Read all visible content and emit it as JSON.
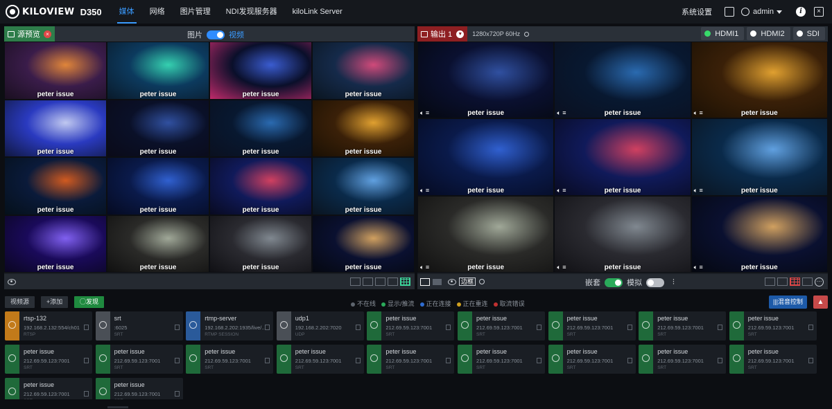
{
  "brand": {
    "logo": "KILOVIEW",
    "model": "D350"
  },
  "nav": [
    "媒体",
    "网络",
    "图片管理",
    "NDI发现服务器",
    "kiloLink Server"
  ],
  "topright": {
    "settings": "系统设置",
    "user": "admin"
  },
  "preview": {
    "tag": "源预览",
    "toggle_left": "图片",
    "toggle_right": "视频",
    "cells": [
      {
        "caption": "peter issue",
        "colors": [
          "#3a1c4a",
          "#e0853a",
          "#1a0f20"
        ]
      },
      {
        "caption": "peter issue",
        "colors": [
          "#0c3a5e",
          "#35d0b0",
          "#0a1a2a"
        ]
      },
      {
        "caption": "peter issue",
        "colors": [
          "#0a0f2a",
          "#3a5cd0",
          "#c02a6a"
        ]
      },
      {
        "caption": "peter issue",
        "colors": [
          "#152a4a",
          "#d04a7a",
          "#0a1520"
        ]
      },
      {
        "caption": "peter issue",
        "colors": [
          "#2a3ac0",
          "#c0c8f0",
          "#101840"
        ]
      },
      {
        "caption": "peter issue",
        "colors": [
          "#0a1028",
          "#3050a0",
          "#0a0a18"
        ]
      },
      {
        "caption": "peter issue",
        "colors": [
          "#081830",
          "#2a6ab0",
          "#0a1020"
        ]
      },
      {
        "caption": "peter issue",
        "colors": [
          "#3a2008",
          "#e0a030",
          "#1a1004"
        ]
      },
      {
        "caption": "peter issue",
        "colors": [
          "#0a1a3a",
          "#d05a20",
          "#05101a"
        ]
      },
      {
        "caption": "peter issue",
        "colors": [
          "#0a1a4a",
          "#3060d0",
          "#050a20"
        ]
      },
      {
        "caption": "peter issue",
        "colors": [
          "#101a5a",
          "#d04060",
          "#080a20"
        ]
      },
      {
        "caption": "peter issue",
        "colors": [
          "#0a2a4a",
          "#60a0e0",
          "#0a1420"
        ]
      },
      {
        "caption": "peter issue",
        "colors": [
          "#1a0a5a",
          "#8060f0",
          "#0a0620"
        ]
      },
      {
        "caption": "peter issue",
        "colors": [
          "#2a2a28",
          "#a0a898",
          "#101010"
        ]
      },
      {
        "caption": "peter issue",
        "colors": [
          "#2a2a30",
          "#808890",
          "#101014"
        ]
      },
      {
        "caption": "peter issue",
        "colors": [
          "#0a1030",
          "#d0a060",
          "#050810"
        ]
      }
    ]
  },
  "output": {
    "tag": "输出 1",
    "resolution": "1280x720P 60Hz",
    "ports": [
      {
        "label": "HDMI1",
        "active": true
      },
      {
        "label": "HDMI2",
        "active": false
      },
      {
        "label": "SDI",
        "active": false
      }
    ],
    "border_label": "边框",
    "ctrl_left": "嵌套",
    "ctrl_right": "模拟",
    "cells": [
      {
        "caption": "peter issue",
        "colors": [
          "#0a1030",
          "#3050a0",
          "#05080f"
        ]
      },
      {
        "caption": "peter issue",
        "colors": [
          "#081830",
          "#2a6ab0",
          "#0a1020"
        ]
      },
      {
        "caption": "peter issue",
        "colors": [
          "#3a2008",
          "#e0a030",
          "#1a1004"
        ]
      },
      {
        "caption": "peter issue",
        "colors": [
          "#0a1a4a",
          "#3060d0",
          "#050a20"
        ]
      },
      {
        "caption": "peter issue",
        "colors": [
          "#101a5a",
          "#d04060",
          "#080a20"
        ]
      },
      {
        "caption": "peter issue",
        "colors": [
          "#0a2a4a",
          "#60a0e0",
          "#0a1420"
        ]
      },
      {
        "caption": "peter issue",
        "colors": [
          "#2a2a28",
          "#a0a898",
          "#101010"
        ]
      },
      {
        "caption": "peter issue",
        "colors": [
          "#2a2a30",
          "#808890",
          "#101014"
        ]
      },
      {
        "caption": "peter issue",
        "colors": [
          "#0a1030",
          "#d0a060",
          "#050810"
        ]
      }
    ]
  },
  "toolbar": {
    "sources": "视频源",
    "add": "+添加",
    "discover": "◯发现",
    "mix": "|||混音控制"
  },
  "legend": [
    {
      "label": "不在线",
      "color": "#5e656e"
    },
    {
      "label": "显示/推流",
      "color": "#2aaa5a"
    },
    {
      "label": "正在连接",
      "color": "#2f6cd0"
    },
    {
      "label": "正在重连",
      "color": "#d0a020"
    },
    {
      "label": "取流错误",
      "color": "#c03030"
    }
  ],
  "sources": [
    {
      "name": "rtsp-132",
      "addr": "192.168.2.132:554/ch01",
      "proto": "RTSP",
      "color": "#c27a1a"
    },
    {
      "name": "srt",
      "addr": ":6025",
      "proto": "SRT",
      "color": "#4a4f56"
    },
    {
      "name": "rtmp-server",
      "addr": "192.168.2.202:1935/live/...",
      "proto": "RTMP SESSION",
      "color": "#2a5a9a"
    },
    {
      "name": "udp1",
      "addr": "192.168.2.202:7020",
      "proto": "UDP",
      "color": "#4a4f56"
    },
    {
      "name": "peter issue",
      "addr": "212.69.59.123:7001",
      "proto": "SRT",
      "color": "#1f6a3a"
    },
    {
      "name": "peter issue",
      "addr": "212.69.59.123:7001",
      "proto": "SRT",
      "color": "#1f6a3a"
    },
    {
      "name": "peter issue",
      "addr": "212.69.59.123:7001",
      "proto": "SRT",
      "color": "#1f6a3a"
    },
    {
      "name": "peter issue",
      "addr": "212.69.59.123:7001",
      "proto": "SRT",
      "color": "#1f6a3a"
    },
    {
      "name": "peter issue",
      "addr": "212.69.59.123:7001",
      "proto": "SRT",
      "color": "#1f6a3a"
    },
    {
      "name": "peter issue",
      "addr": "212.69.59.123:7001",
      "proto": "SRT",
      "color": "#1f6a3a"
    },
    {
      "name": "peter issue",
      "addr": "212.69.59.123:7001",
      "proto": "SRT",
      "color": "#1f6a3a"
    },
    {
      "name": "peter issue",
      "addr": "212.69.59.123:7001",
      "proto": "SRT",
      "color": "#1f6a3a"
    },
    {
      "name": "peter issue",
      "addr": "212.69.59.123:7001",
      "proto": "SRT",
      "color": "#1f6a3a"
    },
    {
      "name": "peter issue",
      "addr": "212.69.59.123:7001",
      "proto": "SRT",
      "color": "#1f6a3a"
    },
    {
      "name": "peter issue",
      "addr": "212.69.59.123:7001",
      "proto": "SRT",
      "color": "#1f6a3a"
    },
    {
      "name": "peter issue",
      "addr": "212.69.59.123:7001",
      "proto": "SRT",
      "color": "#1f6a3a"
    },
    {
      "name": "peter issue",
      "addr": "212.69.59.123:7001",
      "proto": "SRT",
      "color": "#1f6a3a"
    },
    {
      "name": "peter issue",
      "addr": "212.69.59.123:7001",
      "proto": "SRT",
      "color": "#1f6a3a"
    },
    {
      "name": "peter issue",
      "addr": "212.69.59.123:7001",
      "proto": "SRT",
      "color": "#1f6a3a"
    },
    {
      "name": "peter issue",
      "addr": "212.69.59.123:7001",
      "proto": "SRT",
      "color": "#1f6a3a"
    }
  ]
}
